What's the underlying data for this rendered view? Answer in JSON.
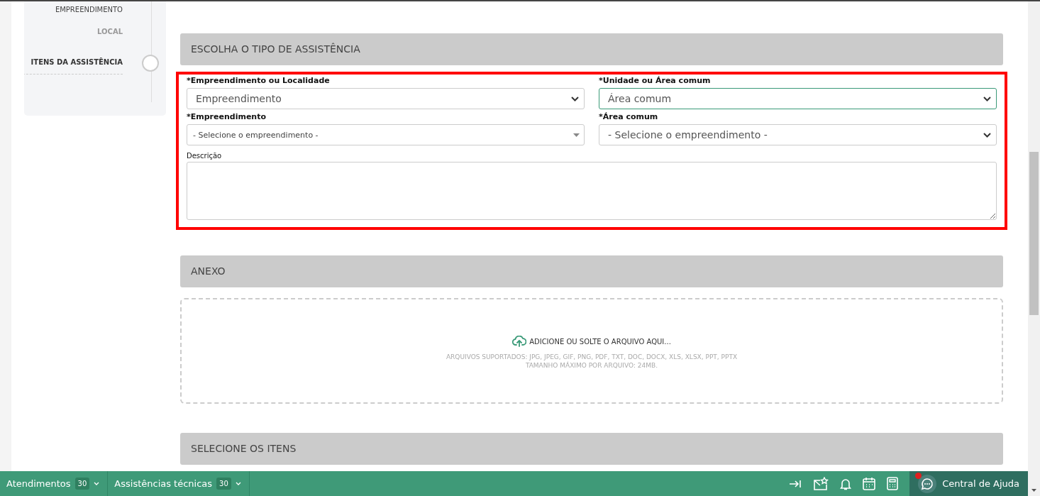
{
  "steps": [
    {
      "label": "EMPREENDIMENTO",
      "selected": false,
      "done": true
    },
    {
      "label": "LOCAL",
      "selected": false,
      "done": false
    },
    {
      "label": "ITENS DA ASSISTÊNCIA",
      "selected": true,
      "done": false
    }
  ],
  "sections": [
    {
      "title": "ESCOLHA O TIPO DE ASSISTÊNCIA",
      "highlighted": true,
      "fields": [
        {
          "label": "*Empreendimento ou Localidade",
          "value": "Empreendimento",
          "kind": "native",
          "focused": false
        },
        {
          "label": "*Unidade ou Área comum",
          "value": "Área comum",
          "kind": "native",
          "focused": true
        },
        {
          "label": "*Empreendimento",
          "value": "- Selecione o empreendimento -",
          "kind": "search",
          "focused": false
        },
        {
          "label": "*Área comum",
          "value": "- Selecione o empreendimento -",
          "kind": "native",
          "focused": false
        }
      ],
      "description": {
        "label": "Descrição"
      }
    },
    {
      "title": "ANEXO",
      "dropzone": {
        "prompt": "ADICIONE OU SOLTE O ARQUIVO AQUI...",
        "formats": "ARQUIVOS SUPORTADOS: JPG, JPEG, GIF, PNG, PDF, TXT, DOC, DOCX, XLS, XLSX, PPT, PPTX",
        "max_size": "TAMANHO MÁXIMO POR ARQUIVO: 24MB."
      }
    },
    {
      "title": "SELECIONE OS ITENS"
    }
  ],
  "bottom_bar": {
    "tabs": [
      {
        "label": "Atendimentos",
        "count": "30"
      },
      {
        "label": "Assistências técnicas",
        "count": "30"
      }
    ],
    "help": {
      "label": "Central de Ajuda",
      "notification": true
    }
  }
}
